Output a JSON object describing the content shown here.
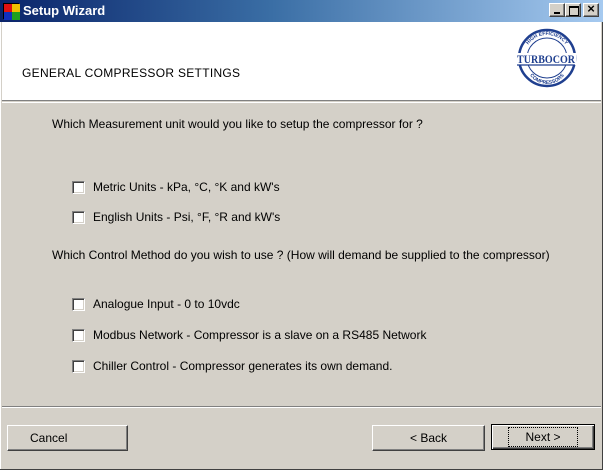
{
  "window": {
    "title": "Setup Wizard",
    "close_glyph": "×"
  },
  "header": {
    "heading": "GENERAL COMPRESSOR SETTINGS",
    "logo_text": "TURBOCOR",
    "logo_ring_top": "HIGH EFFICIENCY",
    "logo_ring_bottom": "COMPRESSORS"
  },
  "measurement": {
    "question": "Which Measurement unit would you like to setup the compressor for ?",
    "options": [
      {
        "label": "Metric Units - kPa, °C, °K and kW's",
        "checked": false
      },
      {
        "label": "English Units - Psi, °F, °R and kW's",
        "checked": false
      }
    ]
  },
  "control": {
    "question": "Which Control Method do you wish to use ? (How will demand be supplied to the compressor)",
    "options": [
      {
        "label": "Analogue Input - 0 to 10vdc",
        "checked": false
      },
      {
        "label": "Modbus Network - Compressor is a slave on a RS485 Network",
        "checked": false
      },
      {
        "label": "Chiller Control - Compressor generates its own demand.",
        "checked": false
      }
    ]
  },
  "footer": {
    "cancel_label": "Cancel",
    "back_label": "< Back",
    "next_label": "Next >"
  },
  "colors": {
    "titlebar_start": "#0a246a",
    "titlebar_end": "#a6caf0",
    "dialog_face": "#d4d0c8",
    "logo_blue": "#1f3f8f"
  }
}
